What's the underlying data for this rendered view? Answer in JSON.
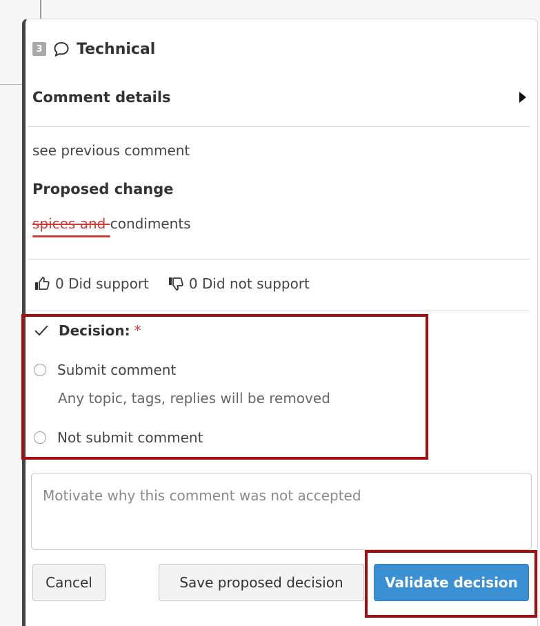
{
  "comment": {
    "number": "3",
    "category": "Technical",
    "details_title": "Comment details",
    "text": "see previous comment",
    "proposed_change_title": "Proposed change",
    "proposed_change_deleted": "spices and ",
    "proposed_change_kept": "condiments"
  },
  "support": {
    "did_support": "0 Did support",
    "did_not_support": "0 Did not support"
  },
  "decision": {
    "label": "Decision:",
    "required_marker": "*",
    "options": [
      {
        "label": "Submit comment",
        "note": "Any topic, tags, replies will be removed",
        "selected": false
      },
      {
        "label": "Not submit comment",
        "selected": false
      }
    ]
  },
  "motivation": {
    "placeholder": "Motivate why this comment was not accepted",
    "value": ""
  },
  "actions": {
    "cancel": "Cancel",
    "save": "Save proposed decision",
    "validate": "Validate decision"
  },
  "colors": {
    "accent_blue": "#3b8fd3",
    "highlight_red": "#a50d10",
    "deletion_red": "#d23a3a"
  },
  "icons": {
    "category": "speech-bubble-icon",
    "expand": "caret-right-icon",
    "support": "thumbs-up-icon",
    "not_support": "thumbs-down-icon",
    "decision": "check-icon"
  }
}
